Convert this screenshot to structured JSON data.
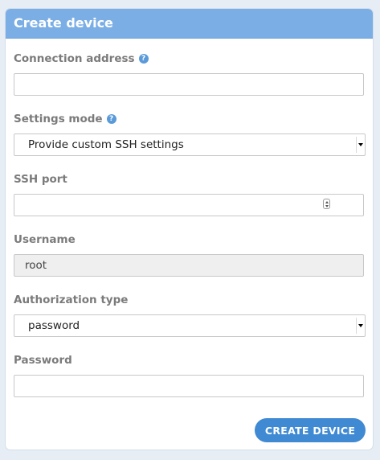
{
  "header": {
    "title": "Create device"
  },
  "fields": {
    "connection_address": {
      "label": "Connection address",
      "help": "?",
      "value": ""
    },
    "settings_mode": {
      "label": "Settings mode",
      "help": "?",
      "selected": "Provide custom SSH settings"
    },
    "ssh_port": {
      "label": "SSH port",
      "value": ""
    },
    "username": {
      "label": "Username",
      "value": "root"
    },
    "authorization_type": {
      "label": "Authorization type",
      "selected": "password"
    },
    "password": {
      "label": "Password",
      "value": ""
    }
  },
  "actions": {
    "create_label": "CREATE DEVICE"
  },
  "colors": {
    "header_bg": "#7aaee5",
    "button_bg": "#3f8ad2",
    "help_icon": "#5a9ad9",
    "label": "#7b7b7b"
  }
}
